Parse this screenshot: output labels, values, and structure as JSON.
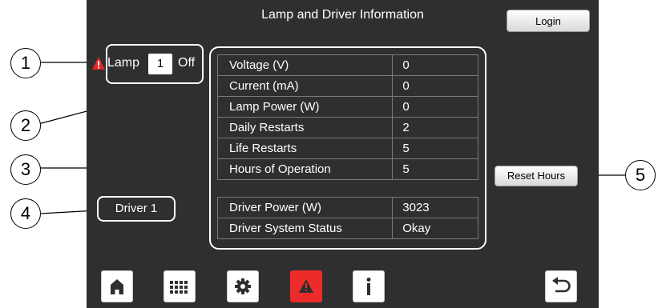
{
  "header": {
    "title": "Lamp and Driver Information",
    "login_label": "Login"
  },
  "lamp": {
    "label": "Lamp",
    "number": "1",
    "state": "Off"
  },
  "lamp_table": [
    {
      "label": "Voltage (V)",
      "value": "0"
    },
    {
      "label": "Current (mA)",
      "value": "0"
    },
    {
      "label": "Lamp Power (W)",
      "value": "0"
    },
    {
      "label": "Daily Restarts",
      "value": "2"
    },
    {
      "label": "Life Restarts",
      "value": "5"
    },
    {
      "label": "Hours of Operation",
      "value": "5"
    }
  ],
  "driver_table": [
    {
      "label": "Driver Power (W)",
      "value": "3023"
    },
    {
      "label": "Driver System Status",
      "value": "Okay"
    }
  ],
  "driver": {
    "label": "Driver 1"
  },
  "reset_label": "Reset Hours",
  "callouts": [
    "1",
    "2",
    "3",
    "4",
    "5"
  ],
  "nav": [
    {
      "icon": "home-icon"
    },
    {
      "icon": "keypad-icon"
    },
    {
      "icon": "gear-icon"
    },
    {
      "icon": "warning-icon"
    },
    {
      "icon": "info-icon"
    },
    {
      "icon": "back-icon"
    }
  ],
  "colors": {
    "screen_bg": "#2f2f2f",
    "alarm_red": "#ee2b2b",
    "text": "#ffffff"
  }
}
